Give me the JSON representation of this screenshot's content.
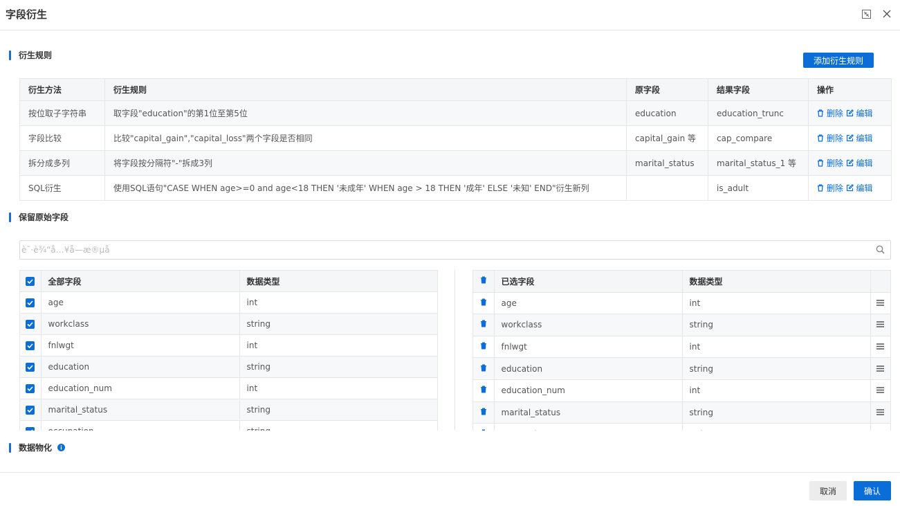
{
  "dialog": {
    "title": "字段衍生",
    "cancel_label": "取消",
    "confirm_label": "确认"
  },
  "derive_section": {
    "title": "衍生规则",
    "add_button": "添加衍生规则",
    "columns": [
      "衍生方法",
      "衍生规则",
      "原字段",
      "结果字段",
      "操作"
    ],
    "delete_label": "删除",
    "edit_label": "编辑",
    "rows": [
      {
        "method": "按位取子字符串",
        "rule": "取字段\"education\"的第1位至第5位",
        "source": "education",
        "result": "education_trunc"
      },
      {
        "method": "字段比较",
        "rule": "比较\"capital_gain\",\"capital_loss\"两个字段是否相同",
        "source": "capital_gain 等",
        "result": "cap_compare"
      },
      {
        "method": "拆分成多列",
        "rule": "将字段按分隔符\"-\"拆成3列",
        "source": "marital_status",
        "result": "marital_status_1 等"
      },
      {
        "method": "SQL衍生",
        "rule": "使用SQL语句\"CASE WHEN age>=0 and age<18 THEN '未成年' WHEN age > 18 THEN '成年' ELSE '未知' END\"衍生新列",
        "source": "",
        "result": "is_adult"
      }
    ]
  },
  "keep_section": {
    "title": "保留原始字段",
    "search_placeholder": "è¯·è¾“å…¥å­—æ®µå",
    "left_columns": [
      "全部字段",
      "数据类型"
    ],
    "right_columns": [
      "已选字段",
      "数据类型"
    ],
    "fields": [
      {
        "name": "age",
        "type": "int"
      },
      {
        "name": "workclass",
        "type": "string"
      },
      {
        "name": "fnlwgt",
        "type": "int"
      },
      {
        "name": "education",
        "type": "string"
      },
      {
        "name": "education_num",
        "type": "int"
      },
      {
        "name": "marital_status",
        "type": "string"
      },
      {
        "name": "occupation",
        "type": "string"
      }
    ]
  },
  "materialize_section": {
    "title": "数据物化"
  },
  "colors": {
    "accent": "#0b6ed8",
    "border": "#e4e7ea",
    "header_bg": "#f4f6f8"
  }
}
